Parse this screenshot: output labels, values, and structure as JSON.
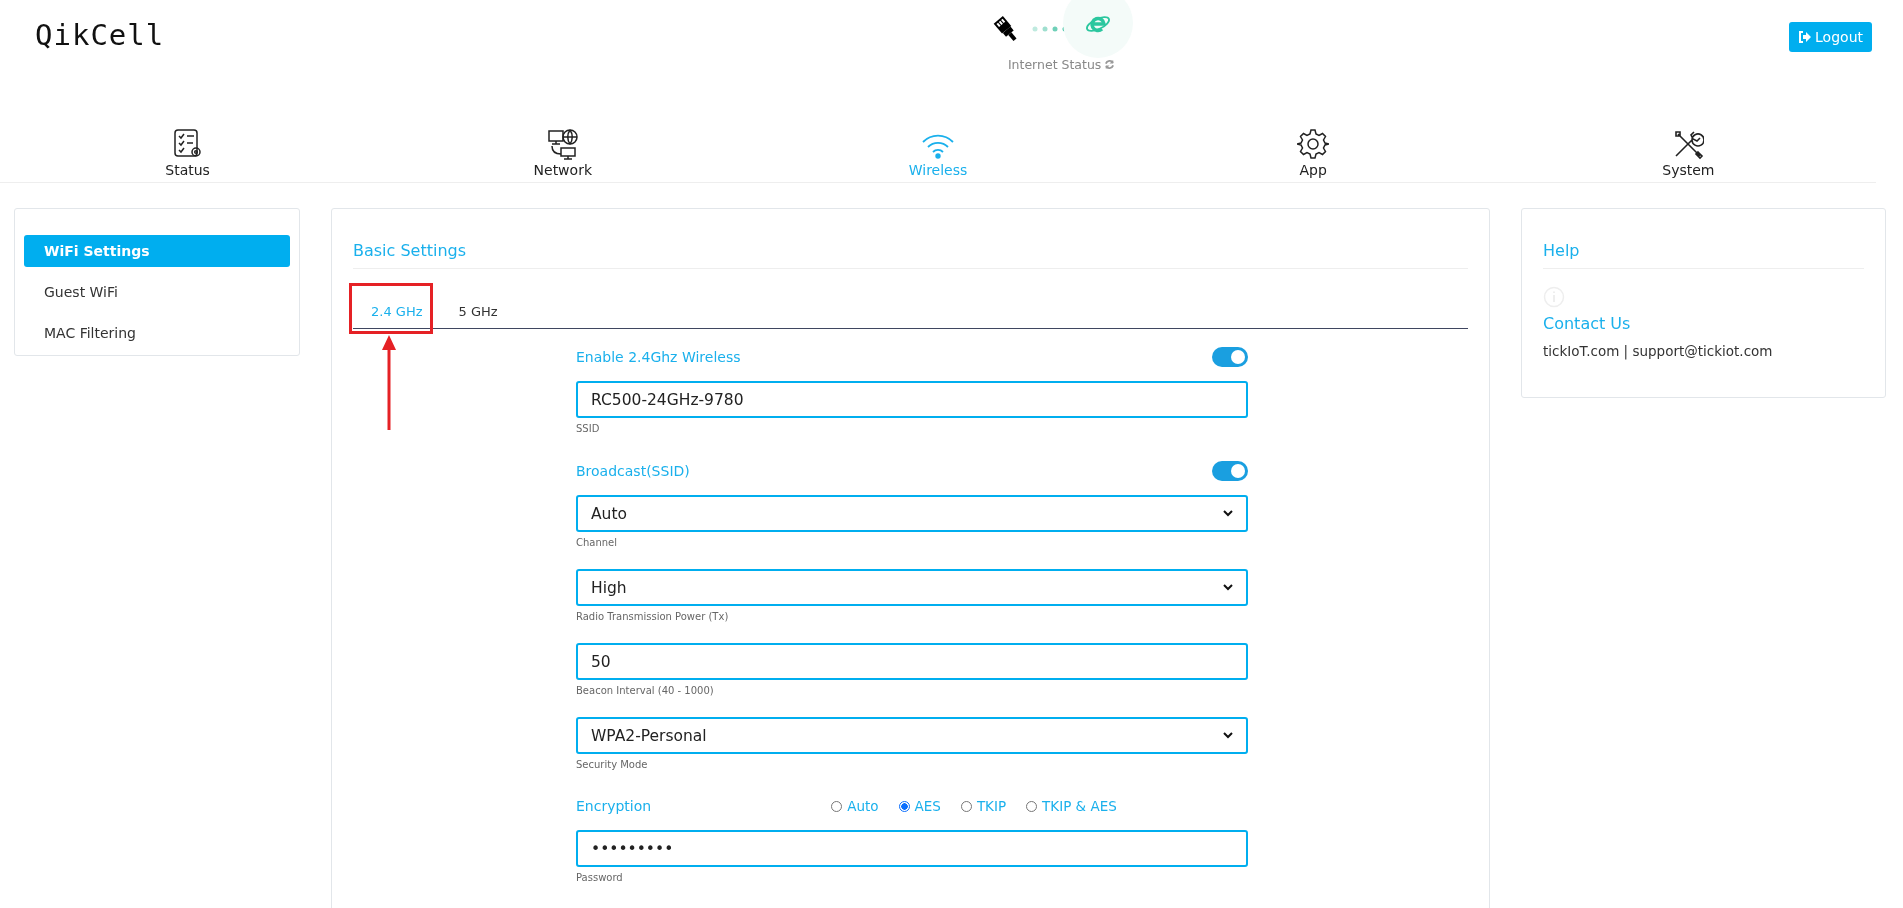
{
  "header": {
    "logo": "QikCell",
    "internet_status": "Internet Status",
    "logout_button": "Logout"
  },
  "nav": [
    {
      "label": "Status",
      "kind": "status",
      "selected": false
    },
    {
      "label": "Network",
      "kind": "network",
      "selected": false
    },
    {
      "label": "Wireless",
      "kind": "wireless",
      "selected": true
    },
    {
      "label": "App",
      "kind": "app",
      "selected": false
    },
    {
      "label": "System",
      "kind": "system",
      "selected": false
    }
  ],
  "sidebar": {
    "items": [
      {
        "label": "WiFi Settings",
        "selected": true
      },
      {
        "label": "Guest WiFi",
        "selected": false
      },
      {
        "label": "MAC Filtering",
        "selected": false
      }
    ]
  },
  "basic_settings": {
    "title": "Basic Settings",
    "tabs": [
      {
        "label": "2.4 GHz",
        "selected": true,
        "highlighted": true
      },
      {
        "label": "5 GHz",
        "selected": false,
        "highlighted": false
      }
    ],
    "fields": [
      {
        "kind": "toggle",
        "label": "Enable 2.4Ghz Wireless",
        "on": true
      },
      {
        "kind": "text",
        "value": "RC500-24GHz-9780",
        "caption": "SSID"
      },
      {
        "kind": "toggle",
        "label": "Broadcast(SSID)",
        "on": true
      },
      {
        "kind": "select",
        "value": "Auto",
        "caption": "Channel"
      },
      {
        "kind": "select",
        "value": "High",
        "caption": "Radio Transmission Power (Tx)"
      },
      {
        "kind": "text",
        "value": "50",
        "caption": "Beacon Interval (40 - 1000)"
      },
      {
        "kind": "select",
        "value": "WPA2-Personal",
        "caption": "Security Mode"
      },
      {
        "kind": "radio",
        "label": "Encryption",
        "options": [
          {
            "label": "Auto",
            "selected": false
          },
          {
            "label": "AES",
            "selected": true
          },
          {
            "label": "TKIP",
            "selected": false
          },
          {
            "label": "TKIP & AES",
            "selected": false
          }
        ]
      },
      {
        "kind": "text",
        "value": "•••••••••",
        "caption": "Password"
      }
    ]
  },
  "help": {
    "title": "Help",
    "contact_title": "Contact Us",
    "contact_text": "tickIoT.com | support@tickiot.com"
  }
}
